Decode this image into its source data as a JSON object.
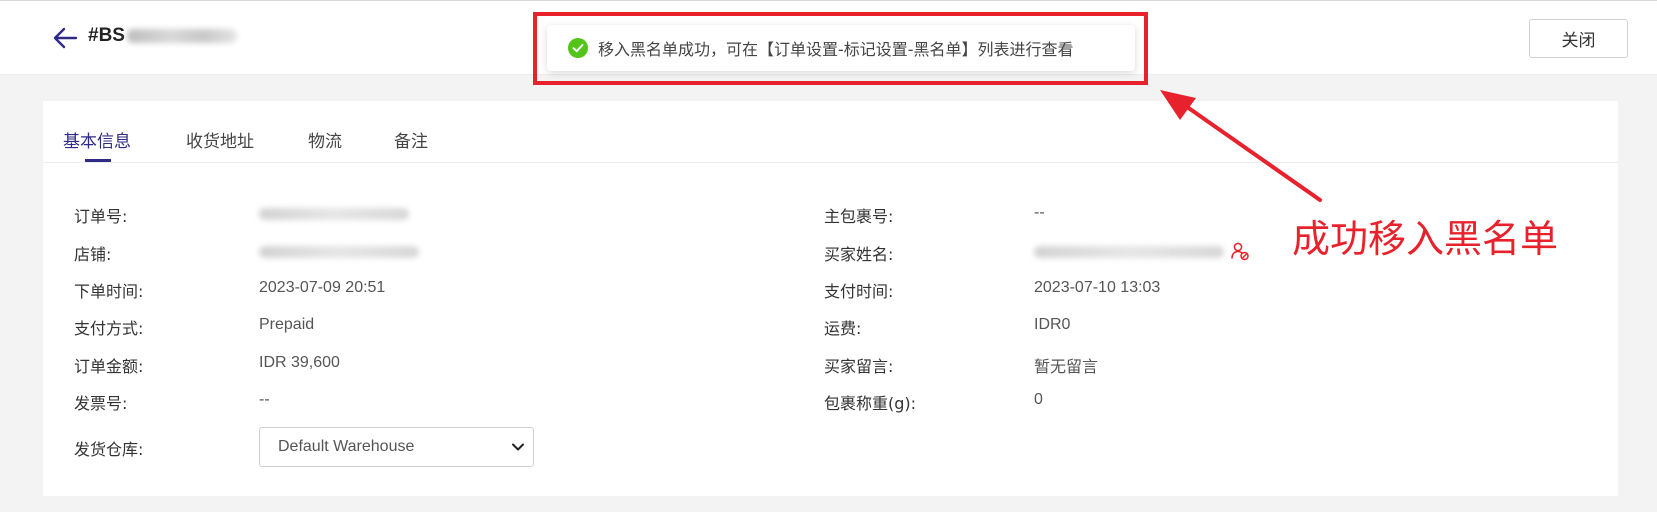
{
  "header": {
    "order_prefix": "#BS",
    "close_label": "关闭"
  },
  "toast": {
    "message": "移入黑名单成功，可在【订单设置-标记设置-黑名单】列表进行查看",
    "status_color": "#52c41a"
  },
  "tabs": [
    {
      "label": "基本信息",
      "active": true
    },
    {
      "label": "收货地址",
      "active": false
    },
    {
      "label": "物流",
      "active": false
    },
    {
      "label": "备注",
      "active": false
    }
  ],
  "left_fields": {
    "order_no": {
      "label": "订单号:"
    },
    "shop": {
      "label": "店铺:"
    },
    "order_time": {
      "label": "下单时间:",
      "value": "2023-07-09 20:51"
    },
    "pay_method": {
      "label": "支付方式:",
      "value": "Prepaid"
    },
    "order_amount": {
      "label": "订单金额:",
      "value": "IDR 39,600"
    },
    "invoice_no": {
      "label": "发票号:",
      "value": "--"
    },
    "warehouse": {
      "label": "发货仓库:",
      "value": "Default Warehouse"
    }
  },
  "right_fields": {
    "main_package": {
      "label": "主包裹号:",
      "value": "--"
    },
    "buyer_name": {
      "label": "买家姓名:"
    },
    "pay_time": {
      "label": "支付时间:",
      "value": "2023-07-10 13:03"
    },
    "shipping_fee": {
      "label": "运费:",
      "value": "IDR0"
    },
    "buyer_message": {
      "label": "买家留言:",
      "value": "暂无留言"
    },
    "package_weight": {
      "label": "包裹称重(g):",
      "value": "0"
    }
  },
  "annotation": {
    "text": "成功移入黑名单",
    "color": "#e8222c"
  },
  "colors": {
    "accent": "#2f2a86",
    "annotation_red": "#e8222c"
  }
}
